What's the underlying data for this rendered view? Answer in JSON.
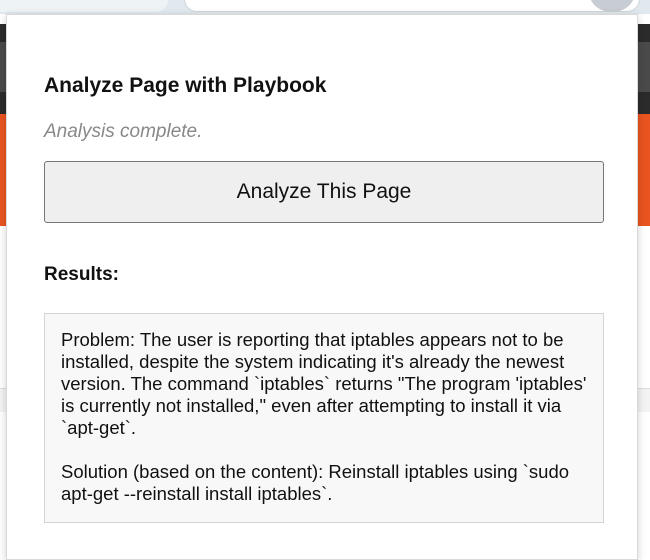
{
  "popup": {
    "title": "Analyze Page with Playbook",
    "status": "Analysis complete.",
    "analyze_button_label": "Analyze This Page",
    "results_label": "Results:",
    "results": {
      "problem": "Problem: The user is reporting that iptables appears not to be installed, despite the system indicating it's already the newest version. The command `iptables` returns \"The program 'iptables' is currently not installed,\" even after attempting to install it via `apt-get`.",
      "solution": "Solution (based on the content): Reinstall iptables using `sudo apt-get --reinstall install iptables`."
    }
  },
  "colors": {
    "page_accent_orange": "#e95420",
    "page_dark_header": "#2b2b2b",
    "button_background": "#efefef",
    "results_background": "#f8f8f8",
    "status_text": "#888888"
  }
}
